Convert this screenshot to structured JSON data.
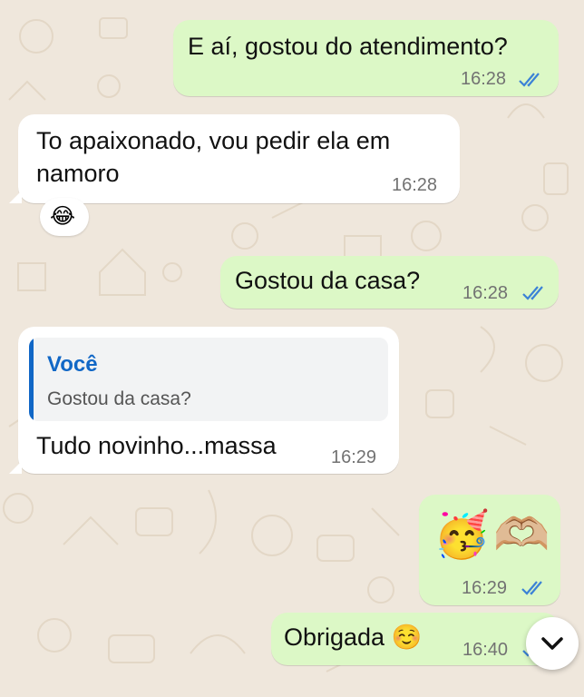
{
  "colors": {
    "background": "#efe7dc",
    "outgoing_bubble": "#dcf8c6",
    "incoming_bubble": "#ffffff",
    "read_ticks": "#3b82d6",
    "quote_accent": "#1167c6"
  },
  "messages": [
    {
      "direction": "outgoing",
      "text": "E aí, gostou do atendimento?",
      "time": "16:28",
      "status": "read"
    },
    {
      "direction": "incoming",
      "text_line1": "To apaixonado,  vou pedir ela em",
      "text_line2": "namoro",
      "time": "16:28",
      "reaction": "😂"
    },
    {
      "direction": "outgoing",
      "text": "Gostou da casa?",
      "time": "16:28",
      "status": "read"
    },
    {
      "direction": "incoming",
      "reply_to": {
        "author": "Você",
        "text": "Gostou da casa?"
      },
      "text": "Tudo novinho...massa",
      "time": "16:29"
    },
    {
      "direction": "outgoing",
      "emojis": [
        "🥳",
        "🫶🏼"
      ],
      "time": "16:29",
      "status": "read"
    },
    {
      "direction": "outgoing",
      "text": "Obrigada ☺️",
      "time": "16:40",
      "status": "read"
    }
  ],
  "scroll_button": {
    "icon": "chevron-down-icon"
  }
}
